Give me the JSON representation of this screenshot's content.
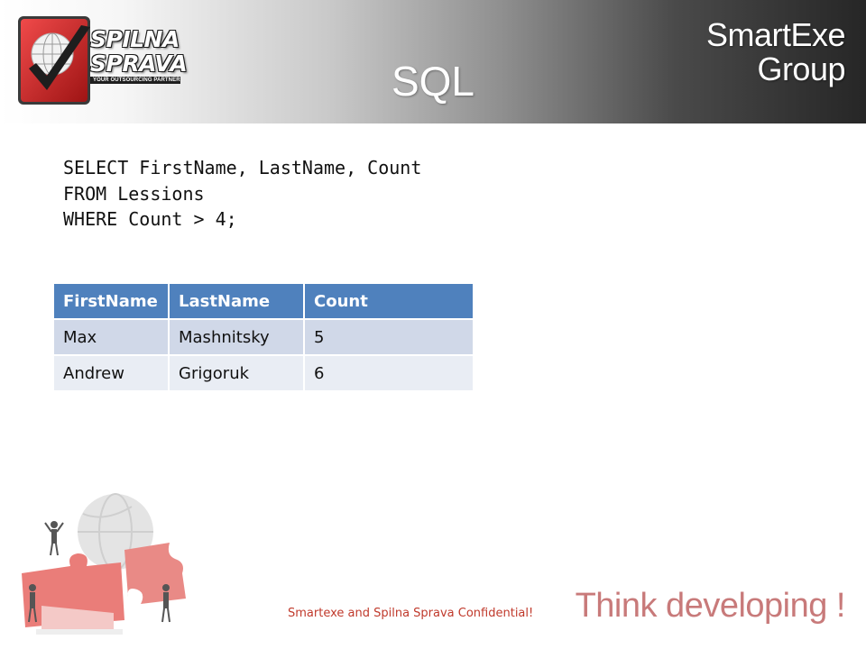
{
  "header": {
    "title": "SQL",
    "brand_line1": "SmartExe",
    "brand_line2": "Group"
  },
  "logo": {
    "icon": "globe-checkmark-logo-icon",
    "line1": "SPILNA",
    "line2": "SPRAVA",
    "tagline": "YOUR OUTSOURCING PARTNER"
  },
  "query": {
    "lines": [
      "SELECT FirstName, LastName, Count",
      "FROM Lessions",
      "WHERE Count > 4;"
    ]
  },
  "result_table": {
    "columns": [
      "FirstName",
      "LastName",
      "Count"
    ],
    "rows": [
      [
        "Max",
        "Mashnitsky",
        "5"
      ],
      [
        "Andrew",
        "Grigoruk",
        "6"
      ]
    ]
  },
  "illustration": {
    "icon": "puzzle-globe-figures-icon"
  },
  "footer": {
    "note": "Smartexe and Spilna Sprava Confidential!",
    "slogan": "Think developing !"
  },
  "colors": {
    "table_header": "#4f81bd",
    "table_row_odd": "#d0d8e8",
    "table_row_even": "#e9edf4",
    "logo_red": "#d42a2a",
    "footer_note": "#c0392b",
    "slogan": "#c87a7a"
  }
}
